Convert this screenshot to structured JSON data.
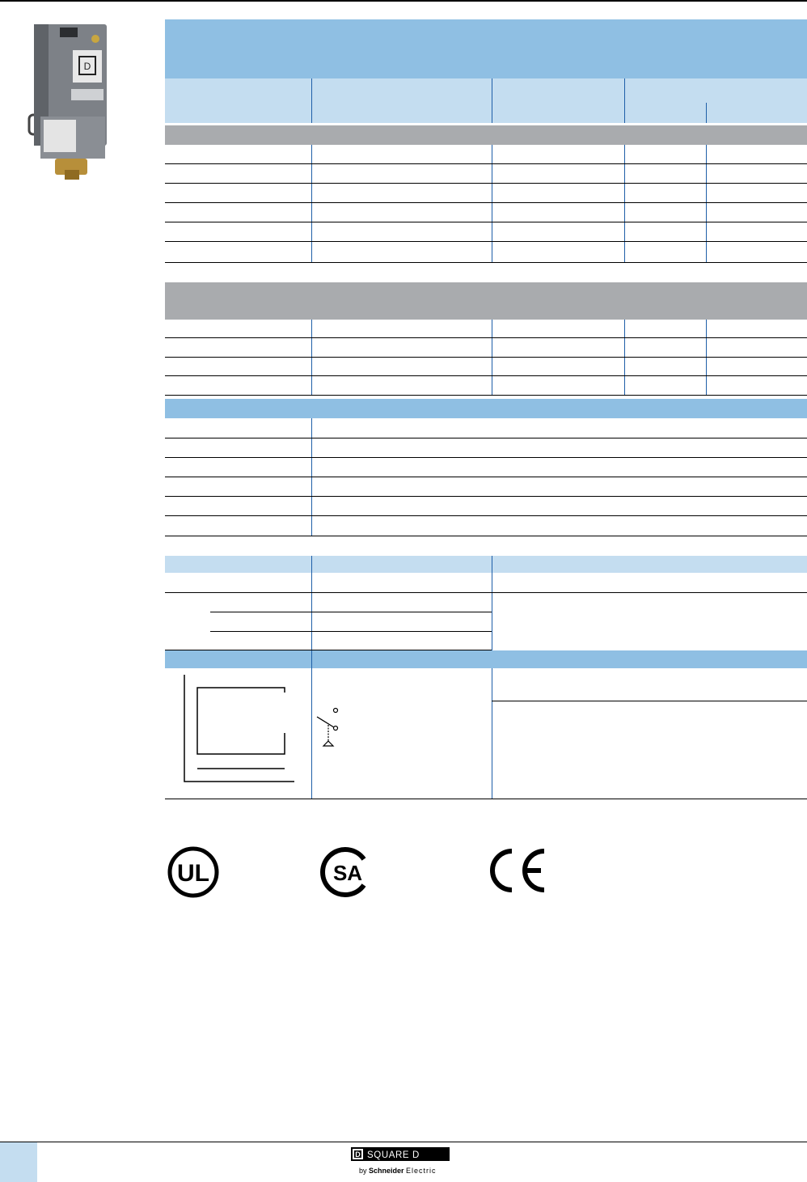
{
  "product_image": {
    "icon": "pressure-switch-device-icon"
  },
  "certifications": [
    {
      "name": "ul-mark-icon",
      "text": "UL"
    },
    {
      "name": "csa-mark-icon",
      "text": "SA"
    },
    {
      "name": "ce-mark-icon",
      "text": "CE"
    }
  ],
  "footer": {
    "brand_box": "D",
    "brand_name": "SQUARE D",
    "byline_prefix": "by ",
    "byline_company": "Schneider",
    "byline_suffix": "Electric"
  },
  "colors": {
    "title_band": "#8fbfe3",
    "header_band": "#c4ddf0",
    "section_gray": "#a9abae",
    "separator_blue": "#1f5fa8"
  }
}
